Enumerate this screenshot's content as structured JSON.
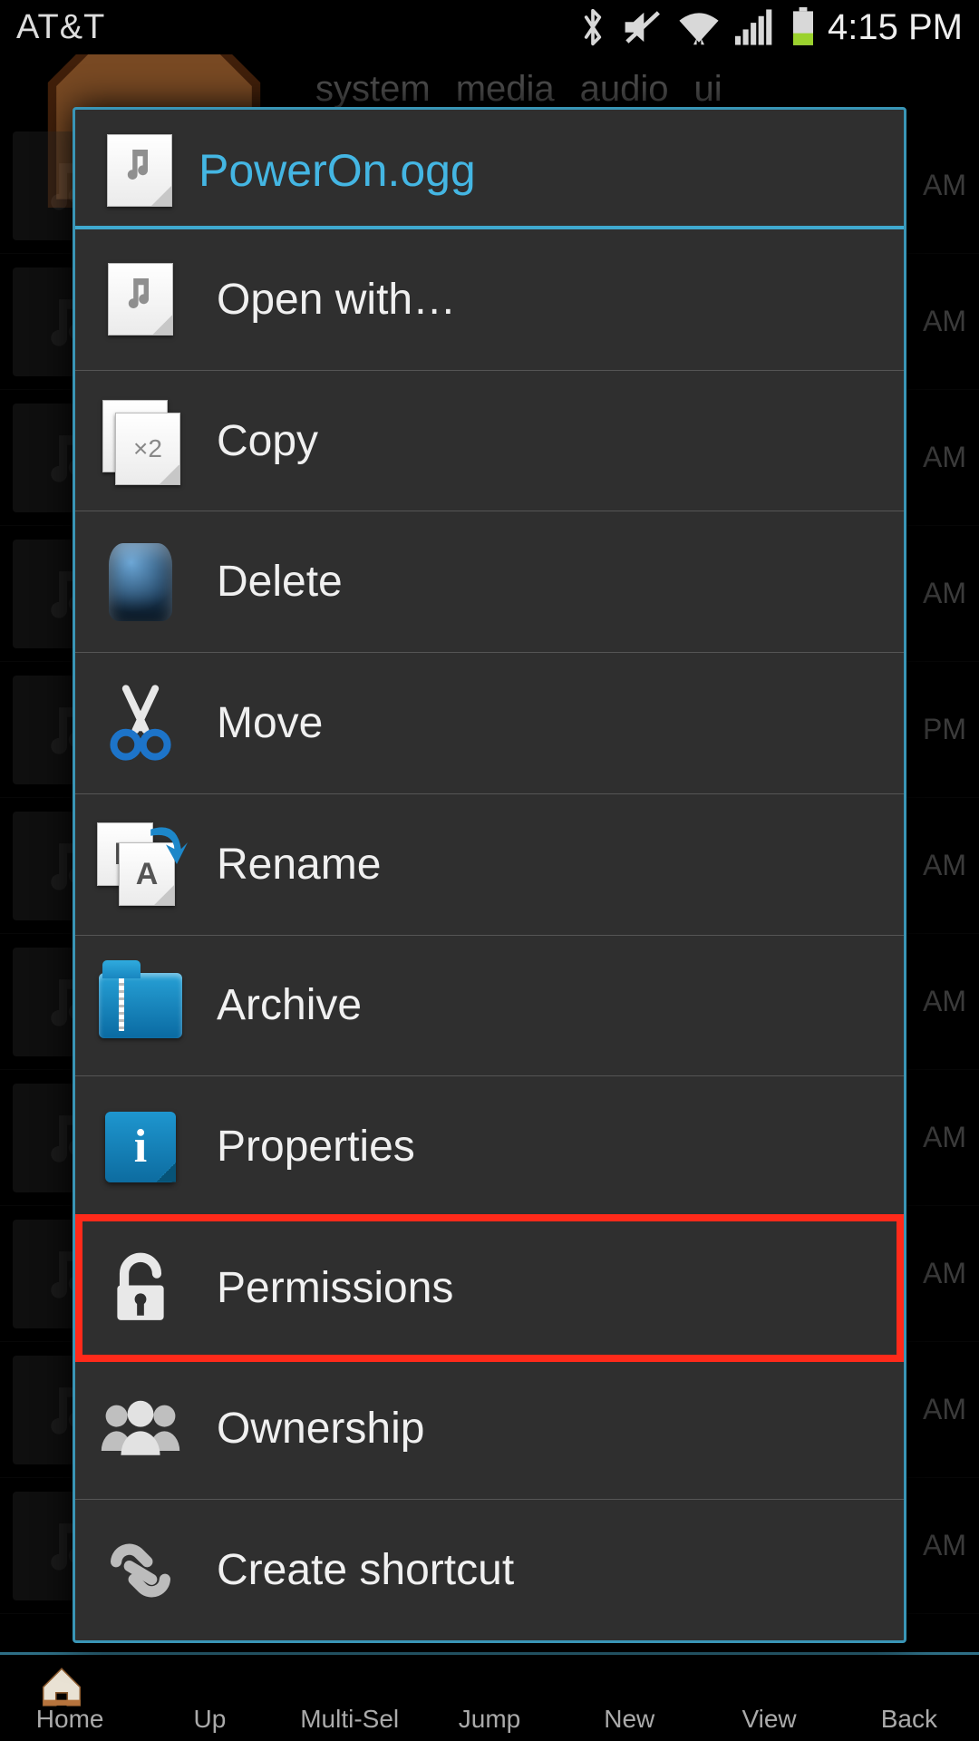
{
  "statusbar": {
    "carrier": "AT&T",
    "clock": "4:15 PM"
  },
  "breadcrumb": [
    "system",
    "media",
    "audio",
    "ui"
  ],
  "bg_times": [
    "AM",
    "AM",
    "AM",
    "AM",
    "PM",
    "AM",
    "AM",
    "AM",
    "AM",
    "AM",
    "AM"
  ],
  "menu": {
    "title": "PowerOn.ogg",
    "items": [
      {
        "label": "Open with…"
      },
      {
        "label": "Copy"
      },
      {
        "label": "Delete"
      },
      {
        "label": "Move"
      },
      {
        "label": "Rename"
      },
      {
        "label": "Archive"
      },
      {
        "label": "Properties"
      },
      {
        "label": "Permissions",
        "highlight": true
      },
      {
        "label": "Ownership"
      },
      {
        "label": "Create shortcut"
      }
    ]
  },
  "toolbar": [
    "Home",
    "Up",
    "Multi-Sel",
    "Jump",
    "New",
    "View",
    "Back"
  ]
}
